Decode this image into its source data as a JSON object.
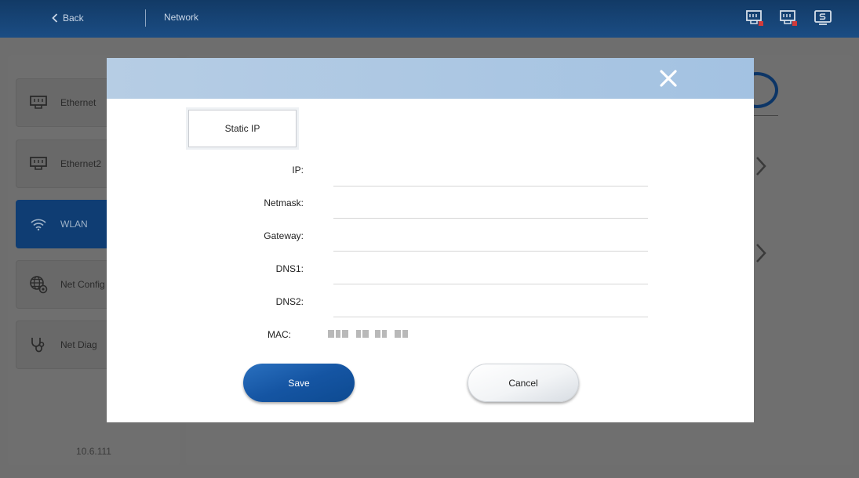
{
  "header": {
    "back_label": "Back",
    "title": "Network",
    "status_icons": [
      "ethernet-disconnected-icon",
      "ethernet2-disconnected-icon",
      "screen-share-icon"
    ]
  },
  "sidebar": {
    "items": [
      {
        "label": "Ethernet",
        "icon": "ethernet-port-icon",
        "active": false
      },
      {
        "label": "Ethernet2",
        "icon": "ethernet-port-icon",
        "active": false
      },
      {
        "label": "WLAN",
        "icon": "wifi-icon",
        "active": true
      },
      {
        "label": "Net Config",
        "icon": "globe-gear-icon",
        "active": false
      },
      {
        "label": "Net Diag",
        "icon": "stethoscope-icon",
        "active": false
      }
    ],
    "version": "10.6.111"
  },
  "dialog": {
    "mode_label": "Static IP",
    "fields": {
      "ip": {
        "label": "IP:",
        "value": ""
      },
      "netmask": {
        "label": "Netmask:",
        "value": ""
      },
      "gateway": {
        "label": "Gateway:",
        "value": ""
      },
      "dns1": {
        "label": "DNS1:",
        "value": ""
      },
      "dns2": {
        "label": "DNS2:",
        "value": ""
      }
    },
    "mac_label": "MAC:",
    "save_label": "Save",
    "cancel_label": "Cancel"
  },
  "colors": {
    "header_bg": "#1b4d84",
    "dialog_header": "#a3c2e2",
    "primary_button": "#1555a3",
    "overlay": "#6e6e6e"
  }
}
